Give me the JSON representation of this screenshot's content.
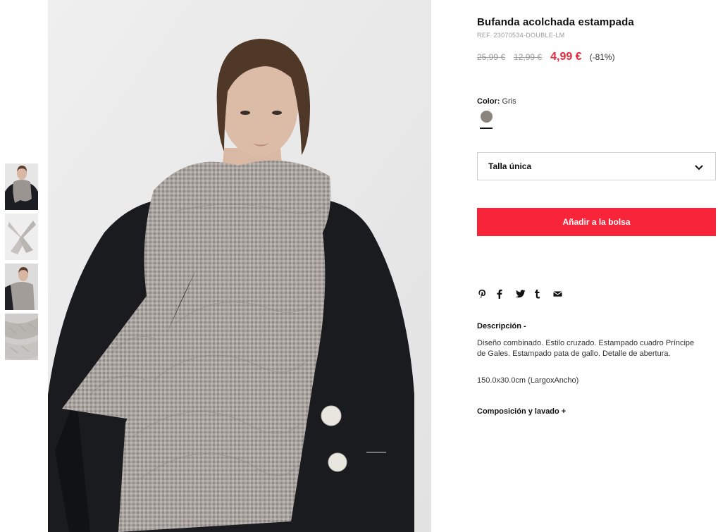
{
  "product": {
    "title": "Bufanda acolchada estampada",
    "ref": "REF. 23070534-DOUBLE-LM",
    "original_price": "25,99 €",
    "previous_price": "12,99 €",
    "current_price": "4,99 €",
    "discount": "(-81%)"
  },
  "color": {
    "label": "Color:",
    "value": "Gris",
    "swatch_hex": "#8c857d"
  },
  "size": {
    "selected": "Talla única"
  },
  "add_to_bag": "Añadir a la bolsa",
  "share_icons": [
    "pinterest-icon",
    "facebook-icon",
    "twitter-icon",
    "tumblr-icon",
    "email-icon"
  ],
  "description": {
    "title": "Descripción -",
    "text": "Diseño combinado. Estilo cruzado. Estampado cuadro Príncipe de Gales. Estampado pata de gallo. Detalle de abertura.",
    "measurements": "150.0x30.0cm (LargoxAncho)"
  },
  "composition": {
    "title": "Composición y lavado +"
  },
  "colors": {
    "accent": "#f7243a",
    "sale_price": "#e5263a"
  }
}
